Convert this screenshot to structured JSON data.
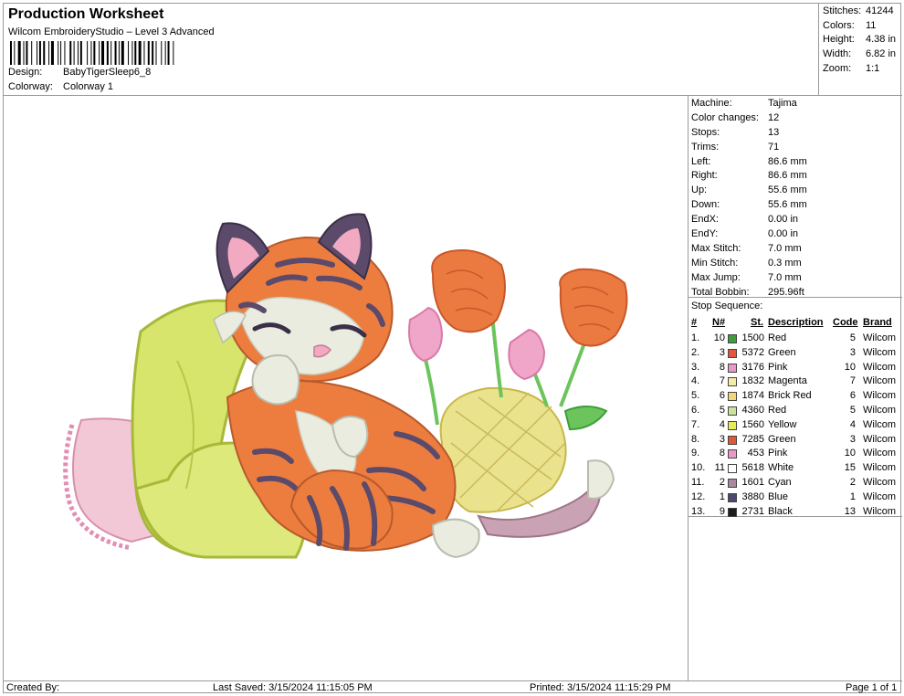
{
  "header": {
    "title": "Production Worksheet",
    "subtitle": "Wilcom EmbroideryStudio – Level 3 Advanced",
    "design_label": "Design:",
    "design_value": "BabyTigerSleep6_8",
    "colorway_label": "Colorway:",
    "colorway_value": "Colorway 1"
  },
  "stats": [
    {
      "label": "Stitches:",
      "value": "41244"
    },
    {
      "label": "Colors:",
      "value": "11"
    },
    {
      "label": "Height:",
      "value": "4.38 in"
    },
    {
      "label": "Width:",
      "value": "6.82 in"
    },
    {
      "label": "Zoom:",
      "value": "1:1"
    }
  ],
  "machine": [
    {
      "label": "Machine:",
      "value": "Tajima"
    },
    {
      "label": "Color changes:",
      "value": "12"
    },
    {
      "label": "Stops:",
      "value": "13"
    },
    {
      "label": "Trims:",
      "value": "71"
    },
    {
      "label": "Left:",
      "value": "86.6 mm"
    },
    {
      "label": "Right:",
      "value": "86.6 mm"
    },
    {
      "label": "Up:",
      "value": "55.6 mm"
    },
    {
      "label": "Down:",
      "value": "55.6 mm"
    },
    {
      "label": "EndX:",
      "value": "0.00 in"
    },
    {
      "label": "EndY:",
      "value": "0.00 in"
    },
    {
      "label": "Max Stitch:",
      "value": "7.0 mm"
    },
    {
      "label": "Min Stitch:",
      "value": "0.3 mm"
    },
    {
      "label": "Max Jump:",
      "value": "7.0 mm"
    },
    {
      "label": "Total Bobbin:",
      "value": "295.96ft"
    }
  ],
  "stop_sequence": {
    "title": "Stop Sequence:",
    "headers": {
      "num": "#",
      "n": "N#",
      "st": "St.",
      "desc": "Description",
      "code": "Code",
      "brand": "Brand"
    },
    "rows": [
      {
        "num": "1.",
        "n": "10",
        "color": "#3f9e3a",
        "st": "1500",
        "desc": "Red",
        "code": "5",
        "brand": "Wilcom"
      },
      {
        "num": "2.",
        "n": "3",
        "color": "#e2563a",
        "st": "5372",
        "desc": "Green",
        "code": "3",
        "brand": "Wilcom"
      },
      {
        "num": "3.",
        "n": "8",
        "color": "#e89ac4",
        "st": "3176",
        "desc": "Pink",
        "code": "10",
        "brand": "Wilcom"
      },
      {
        "num": "4.",
        "n": "7",
        "color": "#f4eba5",
        "st": "1832",
        "desc": "Magenta",
        "code": "7",
        "brand": "Wilcom"
      },
      {
        "num": "5.",
        "n": "6",
        "color": "#f1d77a",
        "st": "1874",
        "desc": "Brick Red",
        "code": "6",
        "brand": "Wilcom"
      },
      {
        "num": "6.",
        "n": "5",
        "color": "#cfe09a",
        "st": "4360",
        "desc": "Red",
        "code": "5",
        "brand": "Wilcom"
      },
      {
        "num": "7.",
        "n": "4",
        "color": "#e5ee52",
        "st": "1560",
        "desc": "Yellow",
        "code": "4",
        "brand": "Wilcom"
      },
      {
        "num": "8.",
        "n": "3",
        "color": "#e2563a",
        "st": "7285",
        "desc": "Green",
        "code": "3",
        "brand": "Wilcom"
      },
      {
        "num": "9.",
        "n": "8",
        "color": "#e89ac4",
        "st": "453",
        "desc": "Pink",
        "code": "10",
        "brand": "Wilcom"
      },
      {
        "num": "10.",
        "n": "11",
        "color": "#ffffff",
        "st": "5618",
        "desc": "White",
        "code": "15",
        "brand": "Wilcom"
      },
      {
        "num": "11.",
        "n": "2",
        "color": "#a98a9c",
        "st": "1601",
        "desc": "Cyan",
        "code": "2",
        "brand": "Wilcom"
      },
      {
        "num": "12.",
        "n": "1",
        "color": "#4b4a6e",
        "st": "3880",
        "desc": "Blue",
        "code": "1",
        "brand": "Wilcom"
      },
      {
        "num": "13.",
        "n": "9",
        "color": "#1d1d1d",
        "st": "2731",
        "desc": "Black",
        "code": "13",
        "brand": "Wilcom"
      }
    ]
  },
  "footer": {
    "created": "Created By:",
    "last_saved": "Last Saved: 3/15/2024 11:15:05 PM",
    "printed": "Printed: 3/15/2024 11:15:29 PM",
    "page": "Page 1 of 1"
  }
}
